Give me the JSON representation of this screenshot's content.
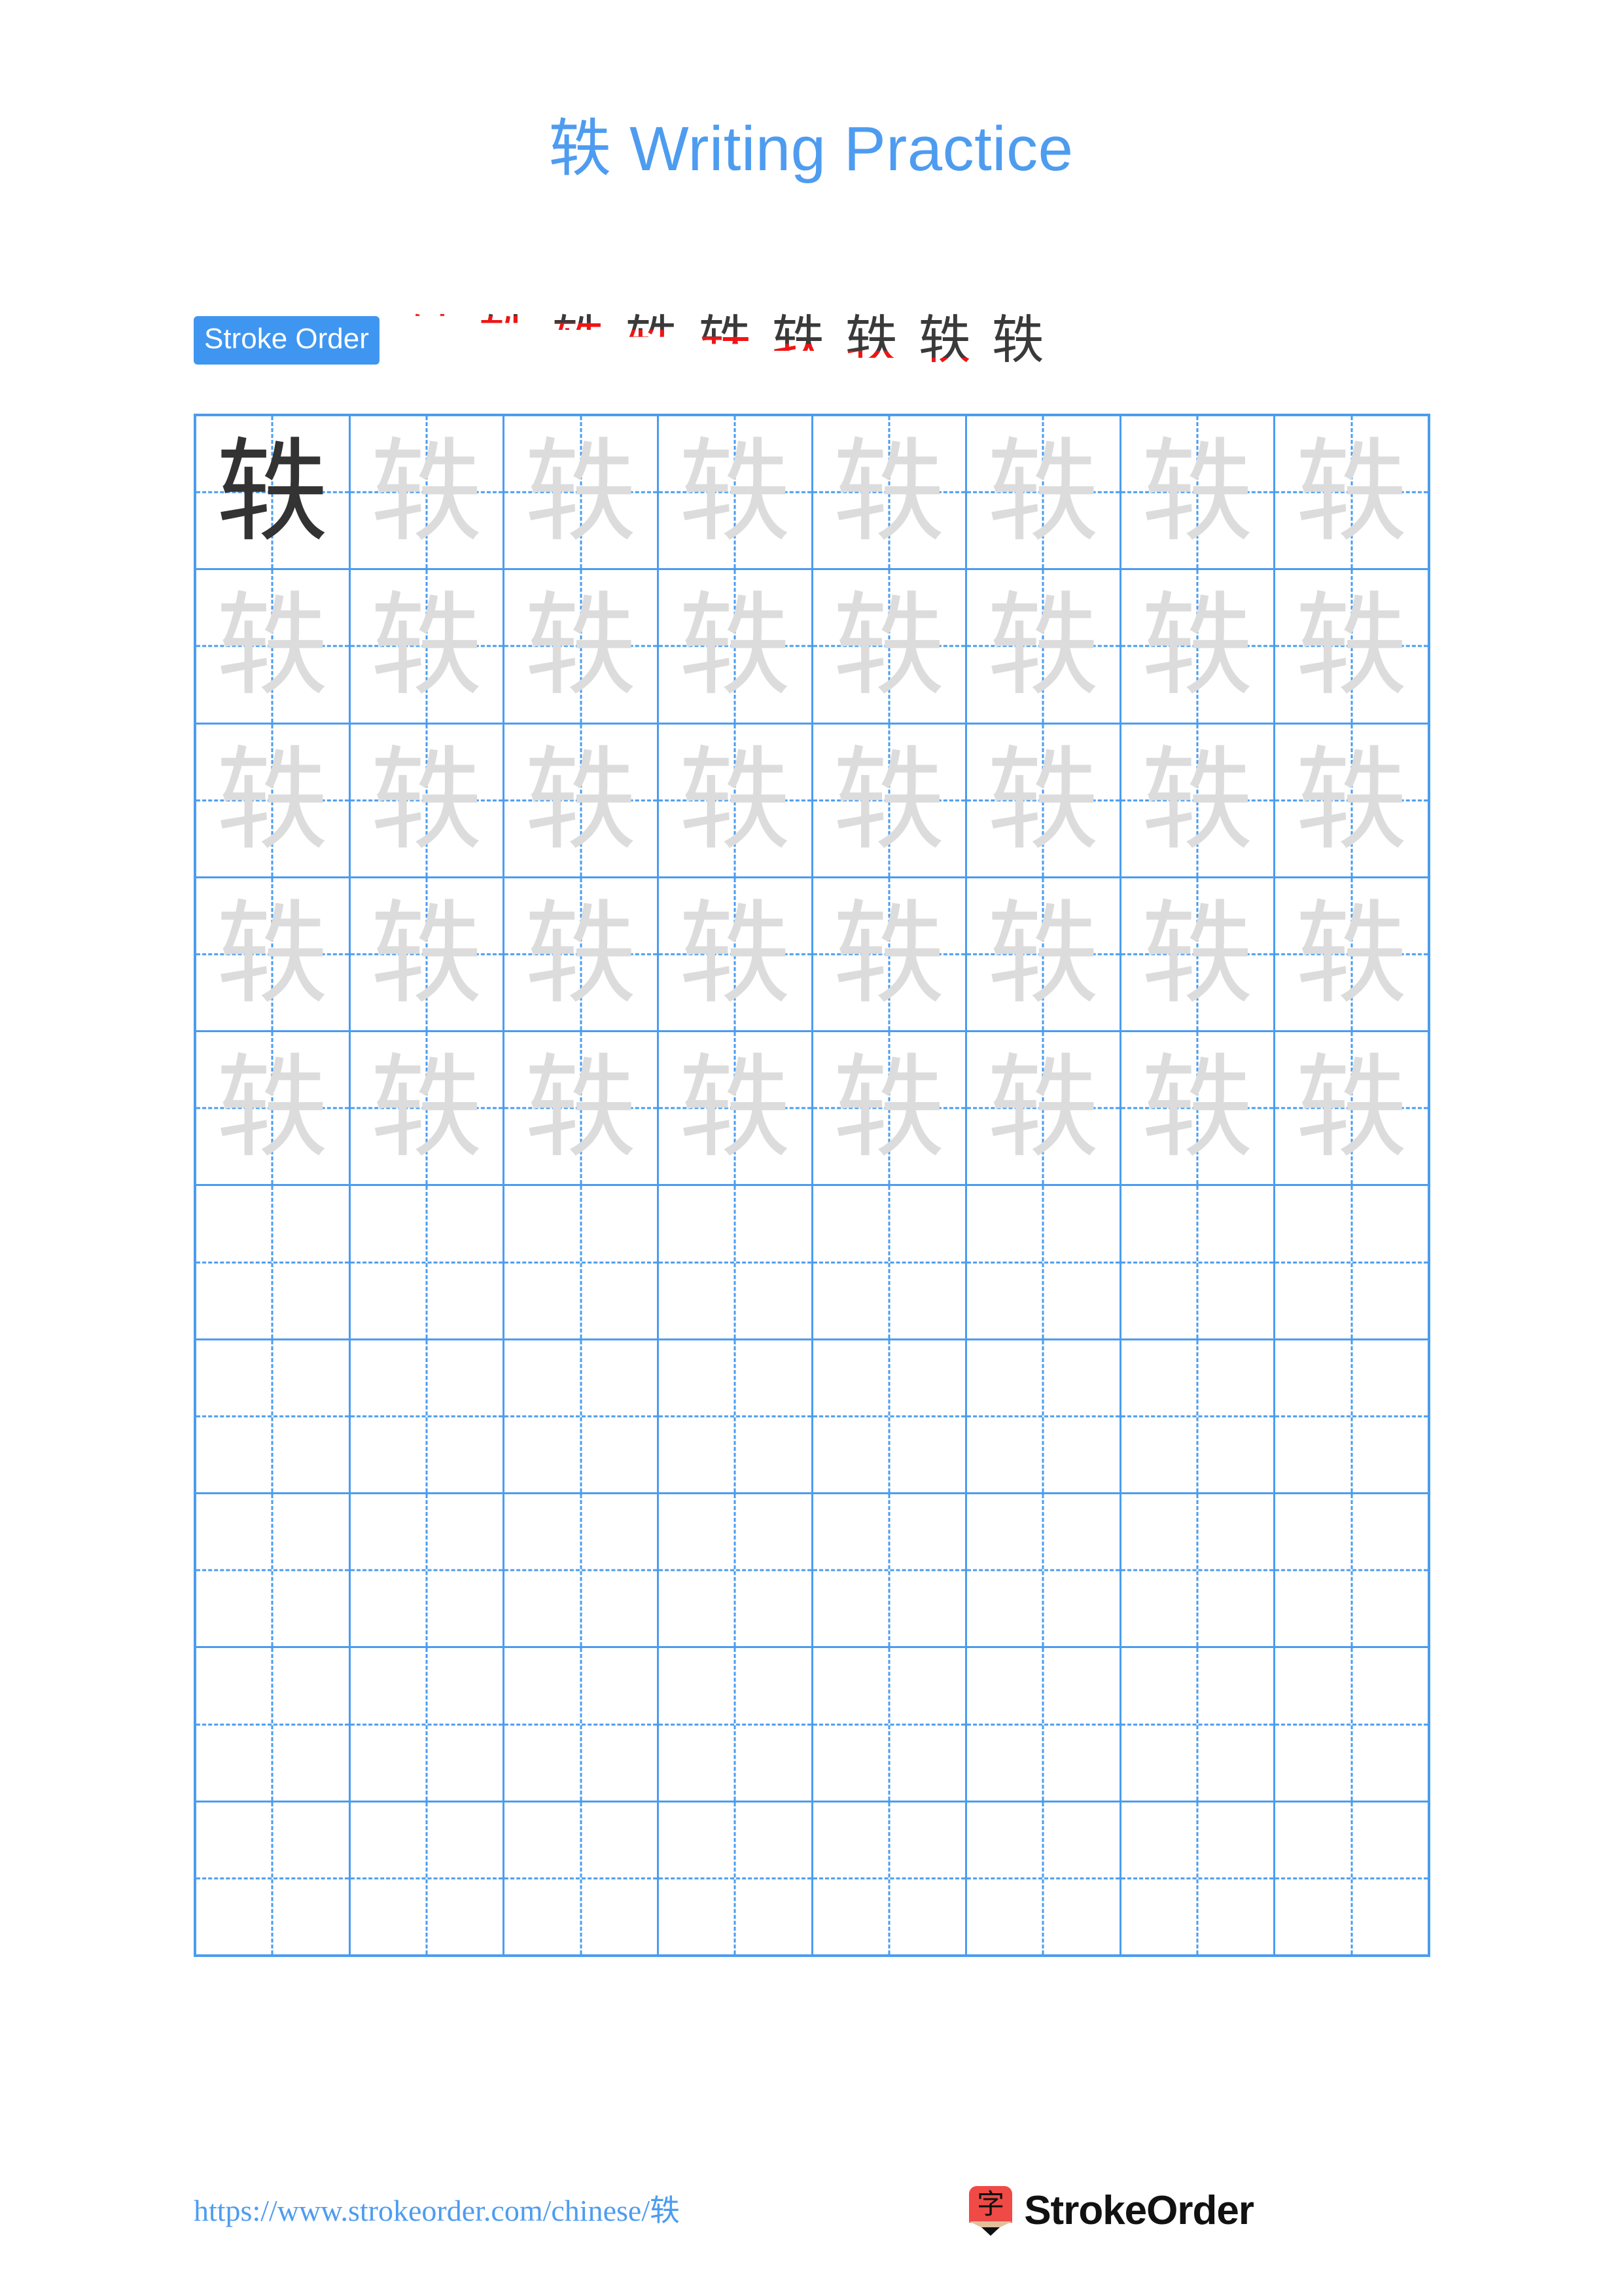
{
  "page": {
    "title": "轶 Writing Practice",
    "character": "轶",
    "background_color": "#ffffff",
    "accent_color": "#4e9cf0"
  },
  "stroke_order": {
    "label": "Stroke Order",
    "badge_bg": "#3f96f0",
    "badge_text_color": "#ffffff",
    "new_stroke_color": "#f01414",
    "drawn_stroke_color": "#3a3a3a",
    "total_strokes": 9,
    "steps": [
      {
        "index": 1,
        "strokes_drawn": 1,
        "glyph": "轶",
        "new_stroke": "㇐ (héng)"
      },
      {
        "index": 2,
        "strokes_drawn": 2,
        "glyph": "轶",
        "new_stroke": "㇜ (shù zhé)"
      },
      {
        "index": 3,
        "strokes_drawn": 3,
        "glyph": "轶",
        "new_stroke": "㇑ (shù)"
      },
      {
        "index": 4,
        "strokes_drawn": 4,
        "glyph": "轶",
        "new_stroke": "㇀ (tí)"
      },
      {
        "index": 5,
        "strokes_drawn": 5,
        "glyph": "轶",
        "new_stroke": "㇓ (piě)"
      },
      {
        "index": 6,
        "strokes_drawn": 6,
        "glyph": "轶",
        "new_stroke": "㇐ (héng)"
      },
      {
        "index": 7,
        "strokes_drawn": 7,
        "glyph": "轶",
        "new_stroke": "㇐ (héng)"
      },
      {
        "index": 8,
        "strokes_drawn": 8,
        "glyph": "轶",
        "new_stroke": "㇑ (shù)"
      },
      {
        "index": 9,
        "strokes_drawn": 9,
        "glyph": "轶",
        "new_stroke": "㇏ (nà)"
      }
    ]
  },
  "grid": {
    "columns": 8,
    "rows": 10,
    "border_color": "#4a9cf0",
    "guide_color": "#4a9cf0",
    "model_char_color": "#333333",
    "trace_char_color": "#dcdcdc",
    "cells": [
      [
        "model",
        "trace",
        "trace",
        "trace",
        "trace",
        "trace",
        "trace",
        "trace"
      ],
      [
        "trace",
        "trace",
        "trace",
        "trace",
        "trace",
        "trace",
        "trace",
        "trace"
      ],
      [
        "trace",
        "trace",
        "trace",
        "trace",
        "trace",
        "trace",
        "trace",
        "trace"
      ],
      [
        "trace",
        "trace",
        "trace",
        "trace",
        "trace",
        "trace",
        "trace",
        "trace"
      ],
      [
        "trace",
        "trace",
        "trace",
        "trace",
        "trace",
        "trace",
        "trace",
        "trace"
      ],
      [
        "blank",
        "blank",
        "blank",
        "blank",
        "blank",
        "blank",
        "blank",
        "blank"
      ],
      [
        "blank",
        "blank",
        "blank",
        "blank",
        "blank",
        "blank",
        "blank",
        "blank"
      ],
      [
        "blank",
        "blank",
        "blank",
        "blank",
        "blank",
        "blank",
        "blank",
        "blank"
      ],
      [
        "blank",
        "blank",
        "blank",
        "blank",
        "blank",
        "blank",
        "blank",
        "blank"
      ],
      [
        "blank",
        "blank",
        "blank",
        "blank",
        "blank",
        "blank",
        "blank",
        "blank"
      ]
    ]
  },
  "footer": {
    "url": "https://www.strokeorder.com/chinese/轶",
    "brand_name": "StrokeOrder",
    "logo_character": "字",
    "logo_body_color": "#f04a46",
    "logo_wood_color": "#e3c09a",
    "logo_tip_color": "#111111"
  }
}
